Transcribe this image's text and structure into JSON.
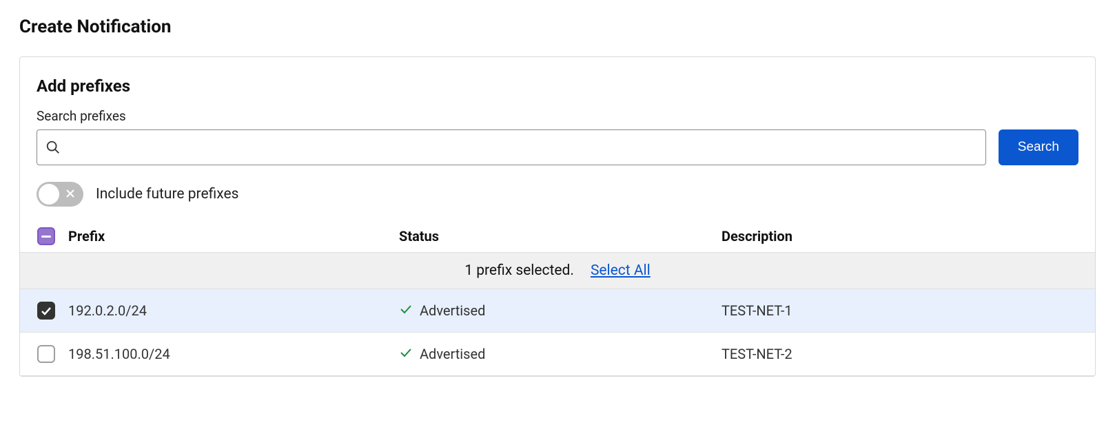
{
  "page_title": "Create Notification",
  "section": {
    "title": "Add prefixes",
    "search_label": "Search prefixes",
    "search_value": "",
    "search_button": "Search",
    "toggle_label": "Include future prefixes",
    "toggle_on": false
  },
  "table": {
    "headers": {
      "prefix": "Prefix",
      "status": "Status",
      "description": "Description"
    },
    "selection_text": "1 prefix selected.",
    "select_all_label": "Select All",
    "rows": [
      {
        "selected": true,
        "prefix": "192.0.2.0/24",
        "status": "Advertised",
        "description": "TEST-NET-1"
      },
      {
        "selected": false,
        "prefix": "198.51.100.0/24",
        "status": "Advertised",
        "description": "TEST-NET-2"
      }
    ]
  }
}
